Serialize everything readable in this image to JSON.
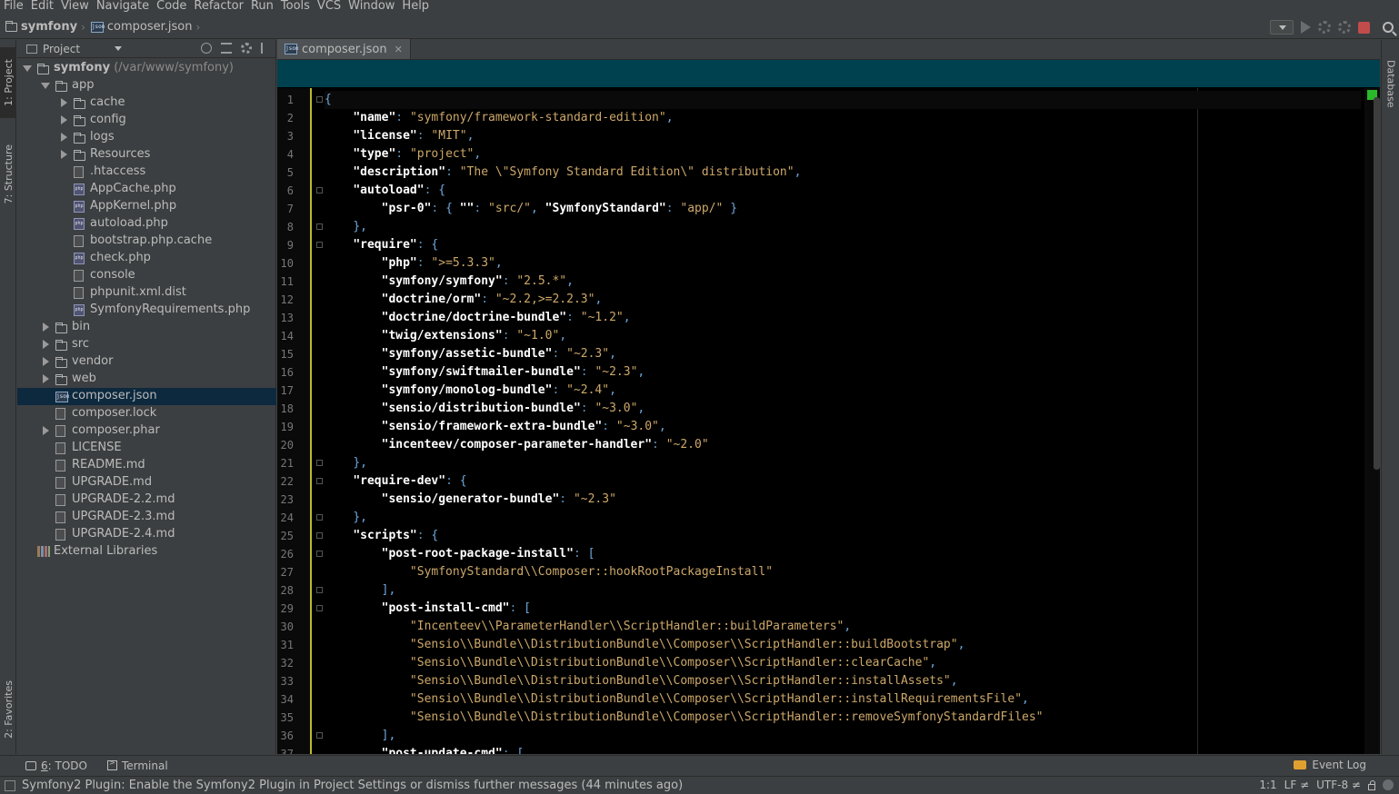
{
  "menu": [
    "File",
    "Edit",
    "View",
    "Navigate",
    "Code",
    "Refactor",
    "Run",
    "Tools",
    "VCS",
    "Window",
    "Help"
  ],
  "breadcrumb": {
    "project": "symfony",
    "file": "composer.json"
  },
  "left_strip": {
    "project_tab": "1: Project",
    "structure_tab": "7: Structure",
    "favorites_tab": "2: Favorites"
  },
  "right_strip": {
    "database_tab": "Database"
  },
  "project_panel": {
    "title": "Project"
  },
  "tree": [
    {
      "label": "symfony",
      "path": " (/var/www/symfony)",
      "depth": 0,
      "arrow": "open",
      "icon": "folder-icon"
    },
    {
      "label": "app",
      "depth": 1,
      "arrow": "open",
      "icon": "folder-icon"
    },
    {
      "label": "cache",
      "depth": 2,
      "arrow": "closed",
      "icon": "folder-icon"
    },
    {
      "label": "config",
      "depth": 2,
      "arrow": "closed",
      "icon": "folder-icon"
    },
    {
      "label": "logs",
      "depth": 2,
      "arrow": "closed",
      "icon": "folder-icon"
    },
    {
      "label": "Resources",
      "depth": 2,
      "arrow": "closed",
      "icon": "folder-icon"
    },
    {
      "label": ".htaccess",
      "depth": 2,
      "arrow": "none",
      "icon": "file-icon"
    },
    {
      "label": "AppCache.php",
      "depth": 2,
      "arrow": "none",
      "icon": "php-icon"
    },
    {
      "label": "AppKernel.php",
      "depth": 2,
      "arrow": "none",
      "icon": "php-icon"
    },
    {
      "label": "autoload.php",
      "depth": 2,
      "arrow": "none",
      "icon": "php-icon"
    },
    {
      "label": "bootstrap.php.cache",
      "depth": 2,
      "arrow": "none",
      "icon": "file-icon"
    },
    {
      "label": "check.php",
      "depth": 2,
      "arrow": "none",
      "icon": "php-icon"
    },
    {
      "label": "console",
      "depth": 2,
      "arrow": "none",
      "icon": "file-icon"
    },
    {
      "label": "phpunit.xml.dist",
      "depth": 2,
      "arrow": "none",
      "icon": "file-icon"
    },
    {
      "label": "SymfonyRequirements.php",
      "depth": 2,
      "arrow": "none",
      "icon": "php-icon"
    },
    {
      "label": "bin",
      "depth": 1,
      "arrow": "closed",
      "icon": "folder-icon"
    },
    {
      "label": "src",
      "depth": 1,
      "arrow": "closed",
      "icon": "folder-icon"
    },
    {
      "label": "vendor",
      "depth": 1,
      "arrow": "closed",
      "icon": "folder-icon"
    },
    {
      "label": "web",
      "depth": 1,
      "arrow": "closed",
      "icon": "folder-icon"
    },
    {
      "label": "composer.json",
      "depth": 1,
      "arrow": "none",
      "icon": "json-icon",
      "selected": true
    },
    {
      "label": "composer.lock",
      "depth": 1,
      "arrow": "none",
      "icon": "file-icon"
    },
    {
      "label": "composer.phar",
      "depth": 1,
      "arrow": "closed",
      "icon": "archive-icon"
    },
    {
      "label": "LICENSE",
      "depth": 1,
      "arrow": "none",
      "icon": "file-icon"
    },
    {
      "label": "README.md",
      "depth": 1,
      "arrow": "none",
      "icon": "file-icon"
    },
    {
      "label": "UPGRADE.md",
      "depth": 1,
      "arrow": "none",
      "icon": "file-icon"
    },
    {
      "label": "UPGRADE-2.2.md",
      "depth": 1,
      "arrow": "none",
      "icon": "file-icon"
    },
    {
      "label": "UPGRADE-2.3.md",
      "depth": 1,
      "arrow": "none",
      "icon": "file-icon"
    },
    {
      "label": "UPGRADE-2.4.md",
      "depth": 1,
      "arrow": "none",
      "icon": "file-icon"
    },
    {
      "label": "External Libraries",
      "depth": 0,
      "arrow": "none",
      "icon": "library-icon"
    }
  ],
  "editor": {
    "tab_label": "composer.json",
    "lines": [
      "{",
      "    \"name\": \"symfony/framework-standard-edition\",",
      "    \"license\": \"MIT\",",
      "    \"type\": \"project\",",
      "    \"description\": \"The \\\"Symfony Standard Edition\\\" distribution\",",
      "    \"autoload\": {",
      "        \"psr-0\": { \"\": \"src/\", \"SymfonyStandard\": \"app/\" }",
      "    },",
      "    \"require\": {",
      "        \"php\": \">=5.3.3\",",
      "        \"symfony/symfony\": \"2.5.*\",",
      "        \"doctrine/orm\": \"~2.2,>=2.2.3\",",
      "        \"doctrine/doctrine-bundle\": \"~1.2\",",
      "        \"twig/extensions\": \"~1.0\",",
      "        \"symfony/assetic-bundle\": \"~2.3\",",
      "        \"symfony/swiftmailer-bundle\": \"~2.3\",",
      "        \"symfony/monolog-bundle\": \"~2.4\",",
      "        \"sensio/distribution-bundle\": \"~3.0\",",
      "        \"sensio/framework-extra-bundle\": \"~3.0\",",
      "        \"incenteev/composer-parameter-handler\": \"~2.0\"",
      "    },",
      "    \"require-dev\": {",
      "        \"sensio/generator-bundle\": \"~2.3\"",
      "    },",
      "    \"scripts\": {",
      "        \"post-root-package-install\": [",
      "            \"SymfonyStandard\\\\Composer::hookRootPackageInstall\"",
      "        ],",
      "        \"post-install-cmd\": [",
      "            \"Incenteev\\\\ParameterHandler\\\\ScriptHandler::buildParameters\",",
      "            \"Sensio\\\\Bundle\\\\DistributionBundle\\\\Composer\\\\ScriptHandler::buildBootstrap\",",
      "            \"Sensio\\\\Bundle\\\\DistributionBundle\\\\Composer\\\\ScriptHandler::clearCache\",",
      "            \"Sensio\\\\Bundle\\\\DistributionBundle\\\\Composer\\\\ScriptHandler::installAssets\",",
      "            \"Sensio\\\\Bundle\\\\DistributionBundle\\\\Composer\\\\ScriptHandler::installRequirementsFile\",",
      "            \"Sensio\\\\Bundle\\\\DistributionBundle\\\\Composer\\\\ScriptHandler::removeSymfonyStandardFiles\"",
      "        ],",
      "        \"post-update-cmd\": ["
    ]
  },
  "bottom_tools": {
    "todo_num": "6",
    "todo": ": TODO",
    "terminal": "Terminal",
    "event_log": "Event Log"
  },
  "status": {
    "message": "Symfony2 Plugin: Enable the Symfony2 Plugin in Project Settings or dismiss further messages (44 minutes ago)",
    "position": "1:1",
    "line_sep": "LF ≠",
    "encoding": "UTF-8 ≠"
  },
  "colors": {
    "editor_bg": "#000000",
    "teal_bar": "#004150",
    "selection": "#0d293e",
    "string": "#cda869",
    "key": "#ffffff"
  }
}
